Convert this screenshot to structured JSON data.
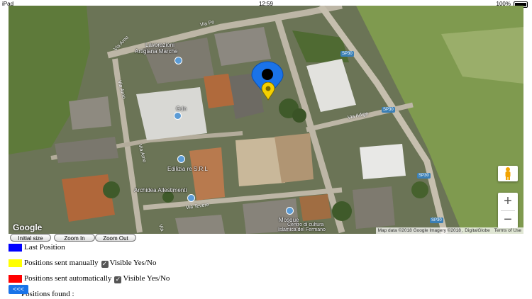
{
  "status": {
    "device": "iPad",
    "time": "12:59",
    "battery": "100%"
  },
  "map": {
    "provider": "Google",
    "attribution": "Map data ©2018 Google Imagery ©2018 , DigitalGlobe",
    "terms": "Terms of Use",
    "zoom_in_symbol": "+",
    "zoom_out_symbol": "−",
    "labels": [
      "Lavorazioni",
      "Artigiana Marche",
      "Gdn",
      "Edilizia re S.R.L",
      "Archidea Allestimenti",
      "Mosque",
      "Centro di cultura",
      "Islamica del Fermano"
    ],
    "roads": [
      "Via Po",
      "Via Arno",
      "Via Arno",
      "Via Arno",
      "Via Adige",
      "Via Tevere",
      "Via"
    ],
    "shields": [
      "SP30",
      "SP30",
      "SP30",
      "SP30"
    ],
    "colors": {
      "last_position_marker": "#1a73e8",
      "manual_marker": "#f5d000"
    }
  },
  "buttons": {
    "initial_size": "Initial size",
    "zoom_in": "Zoom In",
    "zoom_out": "Zoom Out",
    "back": "<<<"
  },
  "legend": {
    "last_position": {
      "label": "Last Position",
      "color": "#0000ff"
    },
    "manual": {
      "label": "Positions sent manually",
      "color": "#ffff00",
      "visible_label": "Visible Yes/No",
      "checked": true
    },
    "automatic": {
      "label": "Positions sent automatically",
      "color": "#ff0000",
      "visible_label": "Visible Yes/No",
      "checked": true
    }
  },
  "positions_found": "Positions found :"
}
